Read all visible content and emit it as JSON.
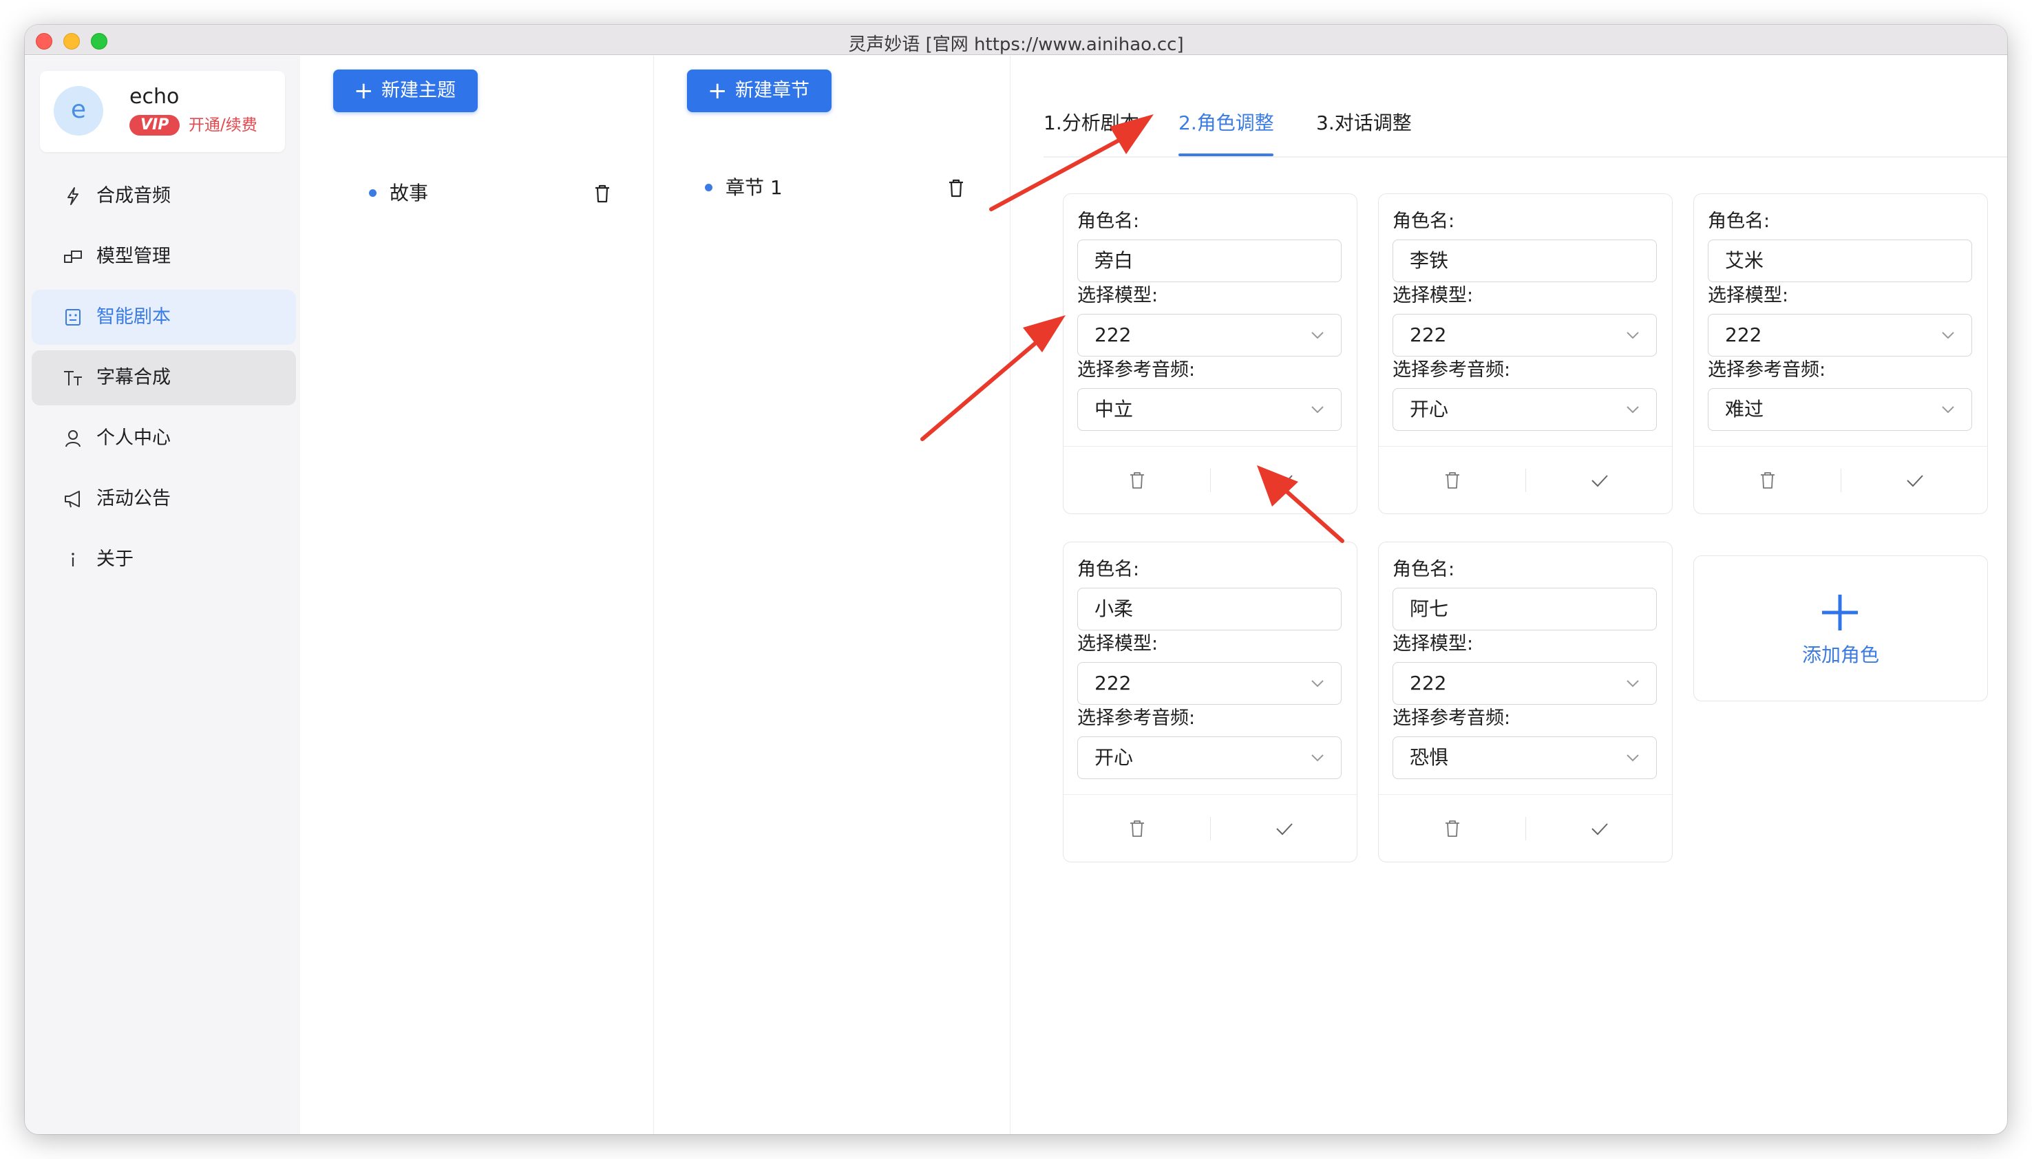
{
  "window": {
    "title": "灵声妙语 [官网 https://www.ainihao.cc]"
  },
  "user": {
    "avatar_letter": "e",
    "name": "echo",
    "vip_label": "VIP",
    "vip_link": "开通/续费"
  },
  "nav": {
    "items": [
      {
        "label": "合成音频",
        "icon": "lightning-icon"
      },
      {
        "label": "模型管理",
        "icon": "model-icon"
      },
      {
        "label": "智能剧本",
        "icon": "script-icon",
        "active": true
      },
      {
        "label": "字幕合成",
        "icon": "text-tt-icon"
      },
      {
        "label": "个人中心",
        "icon": "user-icon"
      },
      {
        "label": "活动公告",
        "icon": "megaphone-icon"
      },
      {
        "label": "关于",
        "icon": "info-icon"
      }
    ]
  },
  "topics": {
    "new_button": "新建主题",
    "items": [
      {
        "label": "故事"
      }
    ]
  },
  "chapters": {
    "new_button": "新建章节",
    "items": [
      {
        "label": "章节 1"
      }
    ]
  },
  "tabs": [
    {
      "label": "1.分析剧本"
    },
    {
      "label": "2.角色调整",
      "active": true
    },
    {
      "label": "3.对话调整"
    }
  ],
  "form_labels": {
    "role_name": "角色名:",
    "model": "选择模型:",
    "ref_audio": "选择参考音频:"
  },
  "roles": [
    {
      "name": "旁白",
      "model": "222",
      "ref_audio": "中立"
    },
    {
      "name": "李铁",
      "model": "222",
      "ref_audio": "开心"
    },
    {
      "name": "艾米",
      "model": "222",
      "ref_audio": "难过"
    },
    {
      "name": "小柔",
      "model": "222",
      "ref_audio": "开心"
    },
    {
      "name": "阿七",
      "model": "222",
      "ref_audio": "恐惧"
    }
  ],
  "add_role": {
    "label": "添加角色"
  },
  "colors": {
    "accent": "#2f74e8",
    "vip": "#e5484d",
    "arrow": "#e8392b"
  }
}
